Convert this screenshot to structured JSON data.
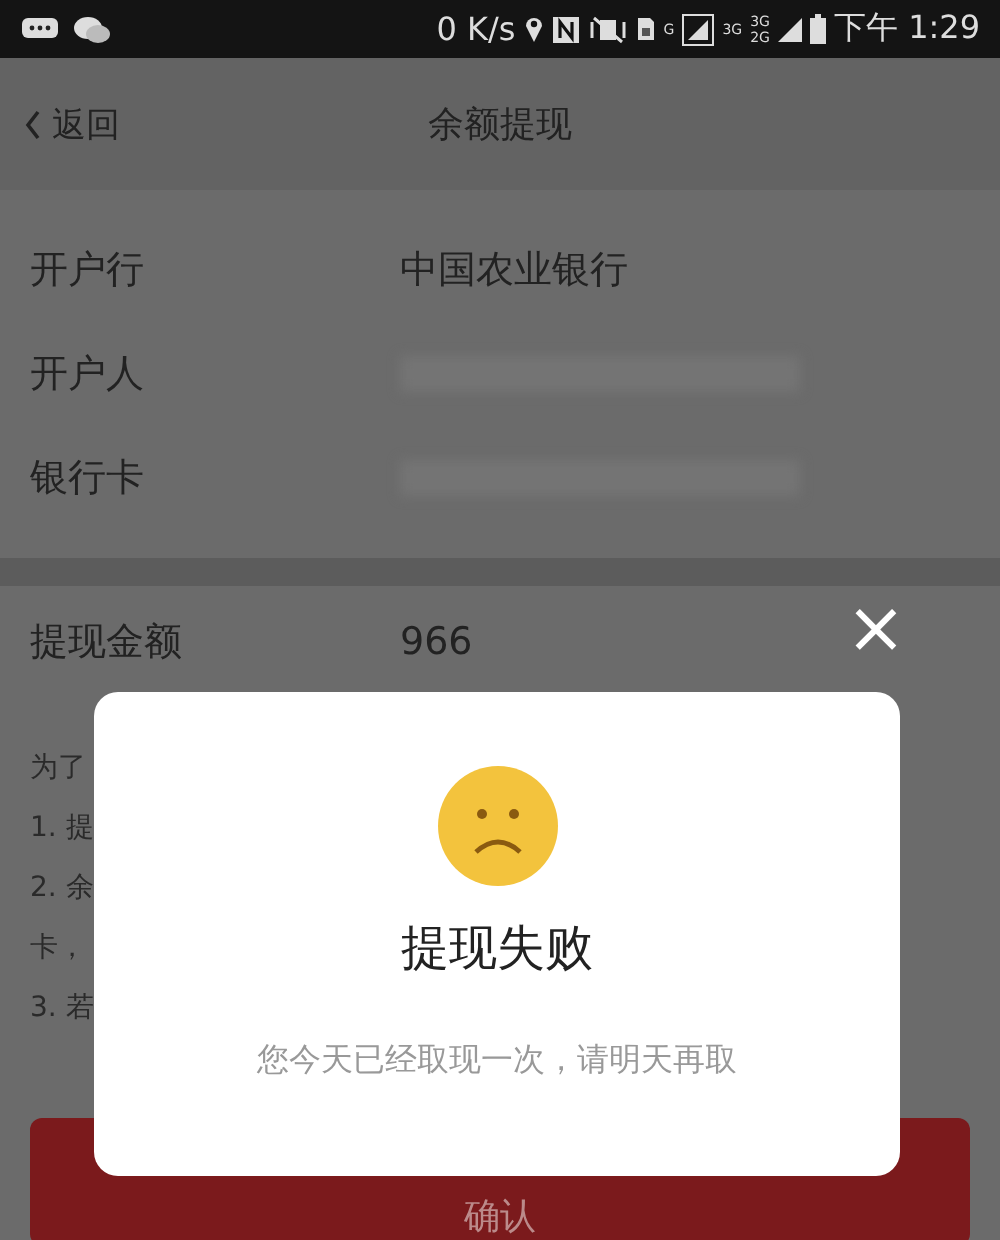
{
  "status_bar": {
    "speed": "0 K/s",
    "net_labels": [
      "G",
      "3G",
      "3G",
      "2G"
    ],
    "time": "下午 1:29"
  },
  "nav": {
    "back": "返回",
    "title": "余额提现"
  },
  "account_rows": [
    {
      "label": "开户行",
      "value": "中国农业银行",
      "redacted": false
    },
    {
      "label": "开户人",
      "value": "",
      "redacted": true
    },
    {
      "label": "银行卡",
      "value": "",
      "redacted": true
    }
  ],
  "amount": {
    "label": "提现金额",
    "value": "966"
  },
  "notes": [
    "为了",
    "1. 提",
    "2. 余",
    "卡，",
    "3. 若"
  ],
  "confirm_button": "确认",
  "dialog": {
    "close": "×",
    "title": "提现失败",
    "message": "您今天已经取现一次，请明天再取"
  }
}
